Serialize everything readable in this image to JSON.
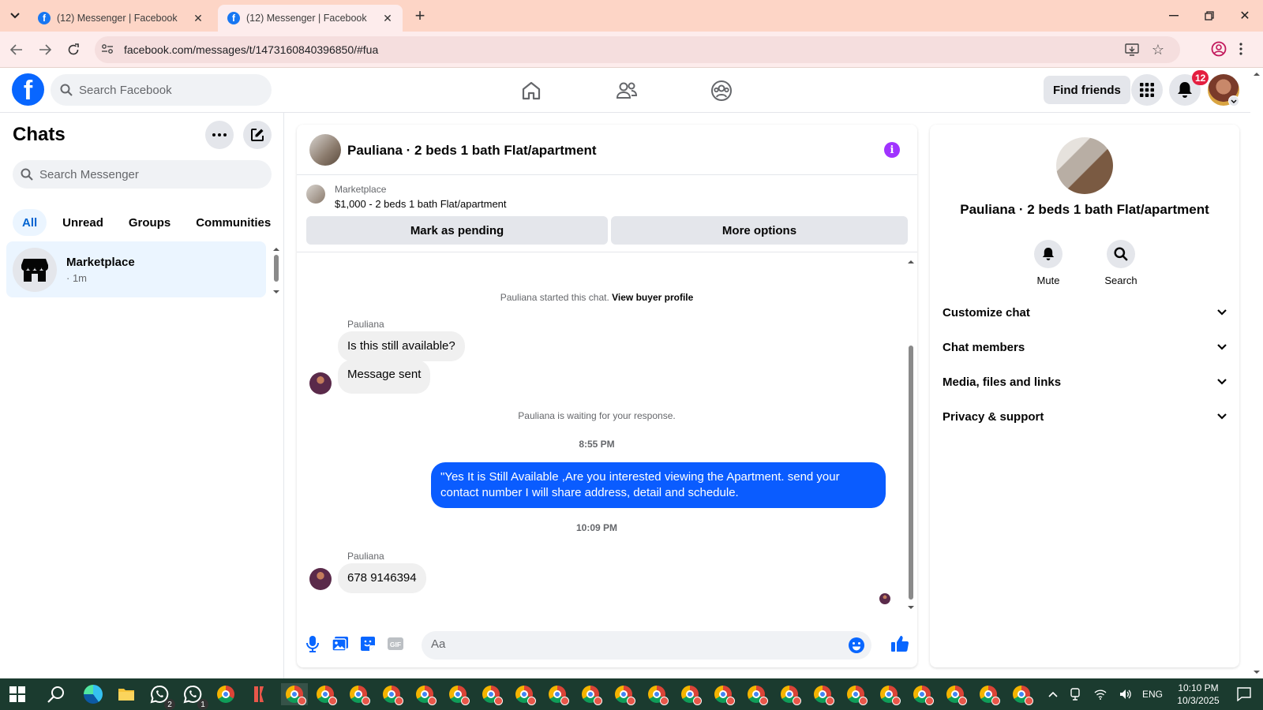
{
  "browser": {
    "tabs": [
      {
        "title": "(12) Messenger | Facebook",
        "active": false
      },
      {
        "title": "(12) Messenger | Facebook",
        "active": true
      }
    ],
    "url": "facebook.com/messages/t/1473160840396850/#fua"
  },
  "fb_header": {
    "logo": "f",
    "search_placeholder": "Search Facebook",
    "find_friends_label": "Find friends",
    "notification_count": "12"
  },
  "chats_panel": {
    "title": "Chats",
    "search_placeholder": "Search Messenger",
    "filters": [
      "All",
      "Unread",
      "Groups",
      "Communities"
    ],
    "active_filter": "All",
    "chat_list": [
      {
        "name": "Marketplace",
        "subtitle": "· 1m"
      }
    ]
  },
  "conversation": {
    "title": "Pauliana · 2 beds 1 bath Flat/apartment",
    "marketplace_label": "Marketplace",
    "listing_price": "$1,000 - 2 beds 1 bath Flat/apartment",
    "mark_pending_label": "Mark as pending",
    "more_options_label": "More options",
    "started_text": "Pauliana started this chat.",
    "view_buyer_profile": "View buyer profile",
    "sender_name_1": "Pauliana",
    "msg_1": "Is this still available?",
    "msg_2": "Message sent",
    "waiting_text": "Pauliana is waiting for your response.",
    "time_1": "8:55 PM",
    "msg_out": "\"Yes It is Still Available ,Are you interested viewing the Apartment. send your contact number I will share address, detail and schedule.",
    "time_2": "10:09 PM",
    "sender_name_2": "Pauliana",
    "msg_3": "678 9146394",
    "composer_placeholder": "Aa"
  },
  "details_panel": {
    "title": "Pauliana · 2 beds 1 bath Flat/apartment",
    "mute_label": "Mute",
    "search_label": "Search",
    "sections": [
      "Customize chat",
      "Chat members",
      "Media, files and links",
      "Privacy & support"
    ]
  },
  "taskbar": {
    "whatsapp_badge_1": "2",
    "whatsapp_badge_2": "1",
    "language": "ENG",
    "time": "10:10 PM",
    "date": "10/3/2025"
  },
  "colors": {
    "facebook_blue": "#0866ff",
    "outgoing_bubble": "#0a5cff",
    "notification_red": "#e41e3f",
    "tabbar_bg": "#fdd5c6",
    "taskbar_bg": "#1b3b2f",
    "info_purple": "#a033ff"
  },
  "icons": [
    "home-icon",
    "friends-icon",
    "groups-icon",
    "menu-grid-icon",
    "bell-icon",
    "more-dots-icon",
    "compose-icon",
    "search-icon",
    "storefront-icon",
    "info-icon",
    "mic-icon",
    "image-icon",
    "sticker-icon",
    "gif-icon",
    "emoji-icon",
    "thumbs-up-icon",
    "chevron-down-icon"
  ]
}
